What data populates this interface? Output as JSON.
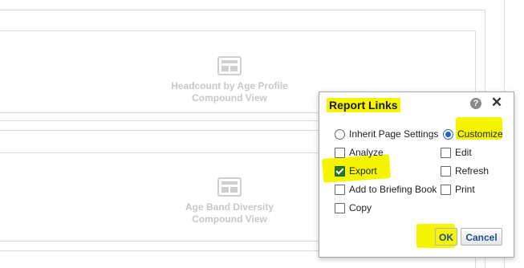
{
  "views": [
    {
      "title": "Headcount by Age Profile",
      "subtitle": "Compound View",
      "icon": "compound-view-icon"
    },
    {
      "title": "Age Band Diversity",
      "subtitle": "Compound View",
      "icon": "compound-view-icon"
    }
  ],
  "dialog": {
    "title": "Report Links",
    "help_icon": "?",
    "close_icon": "✕",
    "radios": [
      {
        "label": "Inherit Page Settings",
        "selected": false
      },
      {
        "label": "Customize",
        "selected": true
      }
    ],
    "checkboxes_left": [
      {
        "label": "Analyze",
        "checked": false
      },
      {
        "label": "Export",
        "checked": true
      },
      {
        "label": "Add to Briefing Book",
        "checked": false
      },
      {
        "label": "Copy",
        "checked": false
      }
    ],
    "checkboxes_right": [
      {
        "label": "Edit",
        "checked": false
      },
      {
        "label": "Refresh",
        "checked": false
      },
      {
        "label": "Print",
        "checked": false
      }
    ],
    "ok_label": "OK",
    "cancel_label": "Cancel"
  },
  "colors": {
    "highlight": "#f5f500",
    "check_green": "#2a7a1f",
    "radio_blue": "#2463c2",
    "button_text": "#1d4f9c"
  }
}
